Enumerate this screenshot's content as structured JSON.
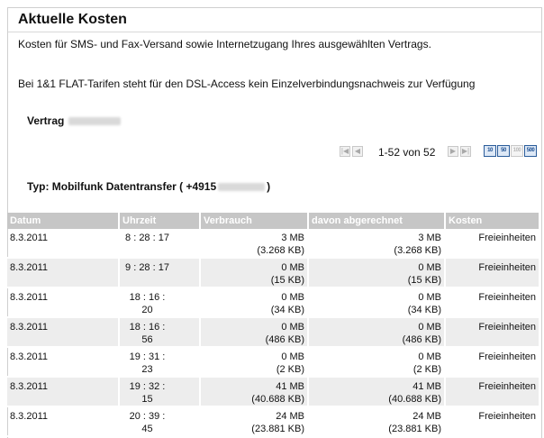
{
  "page": {
    "title": "Aktuelle Kosten",
    "intro": "Kosten für SMS- und Fax-Versand sowie Internetzugang Ihres ausgewählten Vertrags.",
    "note": "Bei 1&1 FLAT-Tarifen steht für den DSL-Access kein Einzelverbindungsnachweis zur Verfügung",
    "vertrag_label": "Vertrag",
    "typ_prefix": "Typ: Mobilfunk Datentransfer ( +4915",
    "typ_suffix": ")"
  },
  "pager": {
    "range_text": "1-52 von 52",
    "first_icon": "first-page-icon",
    "prev_icon": "prev-page-icon",
    "next_icon": "next-page-icon",
    "last_icon": "last-page-icon",
    "page_sizes": [
      "10",
      "50",
      "100",
      "500"
    ]
  },
  "table": {
    "headers": [
      "Datum",
      "Uhrzeit",
      "Verbrauch",
      "davon abgerechnet",
      "Kosten"
    ],
    "rows": [
      {
        "date": "8.3.2011",
        "time": "8 : 28 : 17",
        "usage_mb": "3 MB",
        "usage_kb": "(3.268 KB)",
        "billed_mb": "3 MB",
        "billed_kb": "(3.268 KB)",
        "cost": "Freieinheiten"
      },
      {
        "date": "8.3.2011",
        "time": "9 : 28 : 17",
        "usage_mb": "0 MB",
        "usage_kb": "(15 KB)",
        "billed_mb": "0 MB",
        "billed_kb": "(15 KB)",
        "cost": "Freieinheiten"
      },
      {
        "date": "8.3.2011",
        "time": "18 : 16 : 20",
        "usage_mb": "0 MB",
        "usage_kb": "(34 KB)",
        "billed_mb": "0 MB",
        "billed_kb": "(34 KB)",
        "cost": "Freieinheiten"
      },
      {
        "date": "8.3.2011",
        "time": "18 : 16 : 56",
        "usage_mb": "0 MB",
        "usage_kb": "(486 KB)",
        "billed_mb": "0 MB",
        "billed_kb": "(486 KB)",
        "cost": "Freieinheiten"
      },
      {
        "date": "8.3.2011",
        "time": "19 : 31 : 23",
        "usage_mb": "0 MB",
        "usage_kb": "(2 KB)",
        "billed_mb": "0 MB",
        "billed_kb": "(2 KB)",
        "cost": "Freieinheiten"
      },
      {
        "date": "8.3.2011",
        "time": "19 : 32 : 15",
        "usage_mb": "41 MB",
        "usage_kb": "(40.688 KB)",
        "billed_mb": "41 MB",
        "billed_kb": "(40.688 KB)",
        "cost": "Freieinheiten"
      },
      {
        "date": "8.3.2011",
        "time": "20 : 39 : 45",
        "usage_mb": "24 MB",
        "usage_kb": "(23.881 KB)",
        "billed_mb": "24 MB",
        "billed_kb": "(23.881 KB)",
        "cost": "Freieinheiten"
      }
    ]
  },
  "colors": {
    "header_bg": "#c6c6c6",
    "row_alt_bg": "#ededed",
    "page_size_active": "#2a5c9a"
  }
}
